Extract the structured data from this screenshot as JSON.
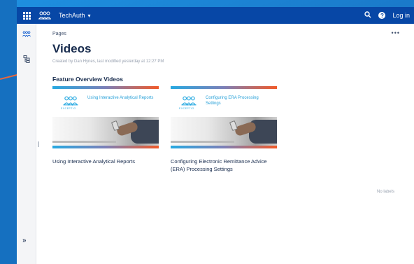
{
  "topbar": {
    "space_name": "TechAuth",
    "login_label": "Log in"
  },
  "page": {
    "breadcrumb": "Pages",
    "more_actions": "•••",
    "title": "Videos",
    "byline": "Created by Dan Hynes, last modified yesterday at 12:27 PM",
    "section_heading": "Feature Overview Videos",
    "no_labels": "No labels"
  },
  "videos": [
    {
      "thumbnail_title": "Using Interactive Analytical Reports",
      "logo_text": "EXCEPTIO",
      "caption": "Using Interactive Analytical Reports"
    },
    {
      "thumbnail_title": "Configuring ERA Processing Settings",
      "logo_text": "EXCEPTIO",
      "caption": "Configuring Electronic Remittance Advice (ERA) Processing Settings"
    }
  ],
  "icons": {
    "app_switcher": "grid-icon",
    "logo": "techauth-logo-icon",
    "search": "search-icon",
    "help": "help-icon",
    "space_sidebar": "space-icon",
    "page_tree": "page-tree-icon",
    "expand": "expand-sidebar-icon"
  },
  "colors": {
    "topbar": "#0747a6",
    "accent_blue": "#27a9e1",
    "accent_orange": "#f15a29"
  }
}
